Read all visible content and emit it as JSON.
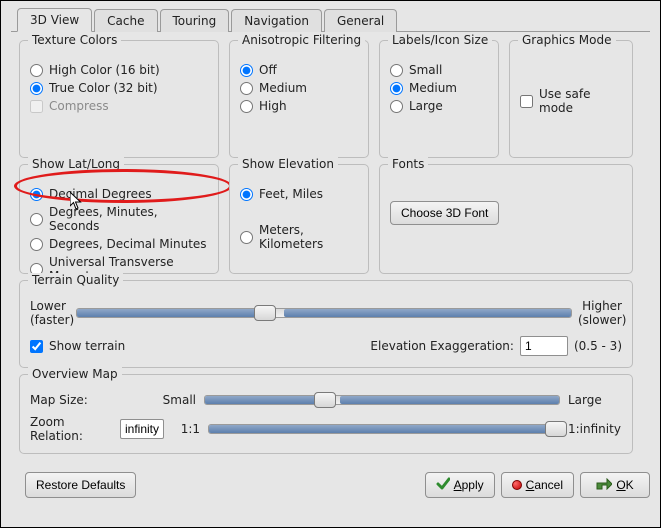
{
  "tabs": [
    "3D View",
    "Cache",
    "Touring",
    "Navigation",
    "General"
  ],
  "active_tab": 0,
  "texture_colors": {
    "legend": "Texture Colors",
    "high": "High Color (16 bit)",
    "true": "True Color (32 bit)",
    "compress": "Compress",
    "selected": "true"
  },
  "aniso": {
    "legend": "Anisotropic Filtering",
    "off": "Off",
    "medium": "Medium",
    "high": "High",
    "selected": "off"
  },
  "labels_icon": {
    "legend": "Labels/Icon Size",
    "small": "Small",
    "medium": "Medium",
    "large": "Large",
    "selected": "medium"
  },
  "graphics": {
    "legend": "Graphics Mode",
    "safe": "Use safe mode",
    "safe_checked": false
  },
  "latlong": {
    "legend": "Show Lat/Long",
    "dd": "Decimal Degrees",
    "dms": "Degrees, Minutes, Seconds",
    "ddm": "Degrees, Decimal Minutes",
    "utm": "Universal Transverse Mercator",
    "selected": "dd"
  },
  "elevation": {
    "legend": "Show Elevation",
    "feet": "Feet, Miles",
    "meters": "Meters, Kilometers",
    "selected": "feet"
  },
  "fonts": {
    "legend": "Fonts",
    "button": "Choose 3D Font"
  },
  "terrain": {
    "legend": "Terrain Quality",
    "lower": "Lower",
    "faster": "(faster)",
    "higher": "Higher",
    "slower": "(slower)",
    "show_terrain": "Show terrain",
    "show_terrain_checked": true,
    "slider_percent": 38,
    "exag_label": "Elevation Exaggeration:",
    "exag_value": "1",
    "exag_range": "(0.5 - 3)"
  },
  "overview": {
    "legend": "Overview Map",
    "map_size_label": "Map Size:",
    "small": "Small",
    "large": "Large",
    "map_size_percent": 34,
    "zoom_label": "Zoom Relation:",
    "zoom_value": "infinity",
    "zoom_lo": "1:1",
    "zoom_hi": "1:infinity",
    "zoom_percent": 100
  },
  "footer": {
    "restore": "Restore Defaults",
    "apply": "Apply",
    "cancel": "Cancel",
    "ok": "OK"
  }
}
